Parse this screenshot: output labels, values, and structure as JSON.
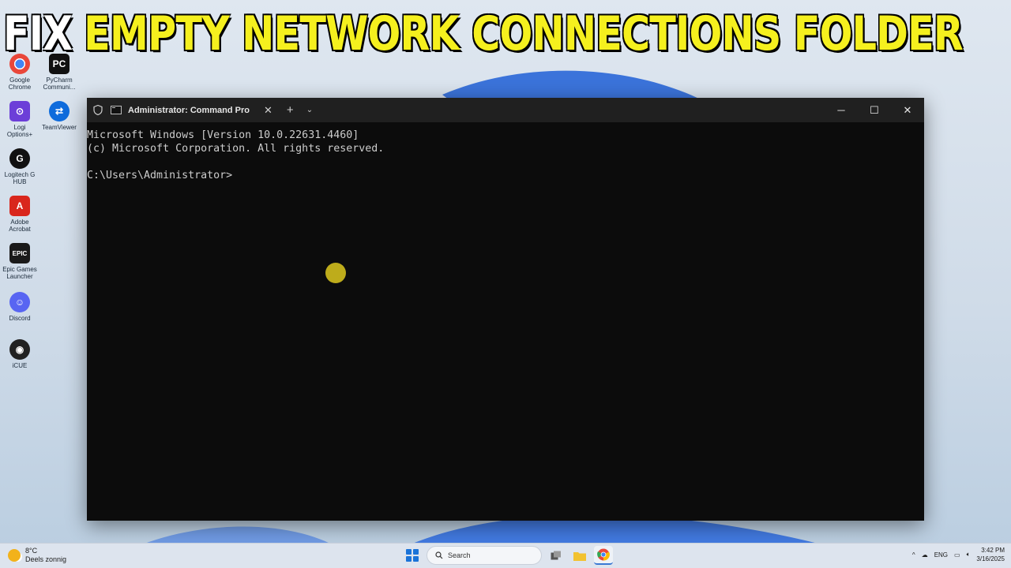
{
  "banner": {
    "word1": "FIX",
    "word2": "EMPTY NETWORK CONNECTIONS FOLDER"
  },
  "desktop_icons": [
    {
      "label": "Google Chrome",
      "icon": "chrome-icon",
      "color": "#e9473a"
    },
    {
      "label": "PyCharm Communi...",
      "icon": "pycharm-icon",
      "color": "#111111"
    },
    {
      "label": "Logi Options+",
      "icon": "logi-options-icon",
      "color": "#6c3ed8"
    },
    {
      "label": "TeamViewer",
      "icon": "teamviewer-icon",
      "color": "#0e6bdc"
    },
    {
      "label": "Logitech G HUB",
      "icon": "logitech-ghub-icon",
      "color": "#111111"
    },
    {
      "label": "Adobe Acrobat",
      "icon": "acrobat-icon",
      "color": "#d9261c"
    },
    {
      "label": "Epic Games Launcher",
      "icon": "epic-games-icon",
      "color": "#1a1a1a"
    },
    {
      "label": "Discord",
      "icon": "discord-icon",
      "color": "#5865f2"
    },
    {
      "label": "iCUE",
      "icon": "icue-icon",
      "color": "#222222"
    }
  ],
  "terminal": {
    "tab_title": "Administrator: Command Pro",
    "lines": [
      "Microsoft Windows [Version 10.0.22631.4460]",
      "(c) Microsoft Corporation. All rights reserved.",
      "",
      "C:\\Users\\Administrator>"
    ],
    "controls": {
      "new_tab": "+",
      "dropdown": "⌄",
      "minimize": "─",
      "maximize": "☐",
      "close": "✕",
      "tab_close": "✕"
    }
  },
  "taskbar": {
    "weather_temp": "8°C",
    "weather_desc": "Deels zonnig",
    "search_placeholder": "Search",
    "language": "ENG",
    "time": "3:42 PM",
    "date": "3/16/2025",
    "tray_chevron": "^"
  }
}
